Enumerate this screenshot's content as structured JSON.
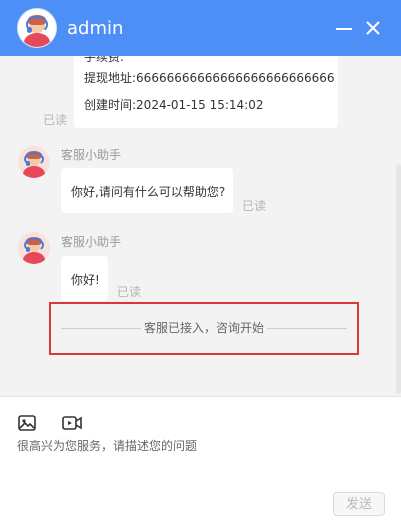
{
  "header": {
    "title": "admin"
  },
  "messages": {
    "order_card": {
      "partial_line": "手续费:",
      "withdraw_label": "提现地址:",
      "withdraw_value": "66666666666666666666666666",
      "created_label": "创建时间:",
      "created_value": "2024-01-15 15:14:02"
    },
    "order_read": "已读",
    "reply1": {
      "sender": "客服小助手",
      "text": "你好,请问有什么可以帮助您?",
      "read": "已读"
    },
    "reply2": {
      "sender": "客服小助手",
      "text": "你好!",
      "read": "已读"
    },
    "system_notice": "客服已接入，咨询开始"
  },
  "composer": {
    "image_icon": "image-icon",
    "video_icon": "video-icon",
    "placeholder": "很高兴为您服务，请描述您的问题",
    "send_label": "发送"
  },
  "colors": {
    "header": "#4e8ef7",
    "highlight_border": "#d9363e",
    "background": "#f3f3f3"
  }
}
